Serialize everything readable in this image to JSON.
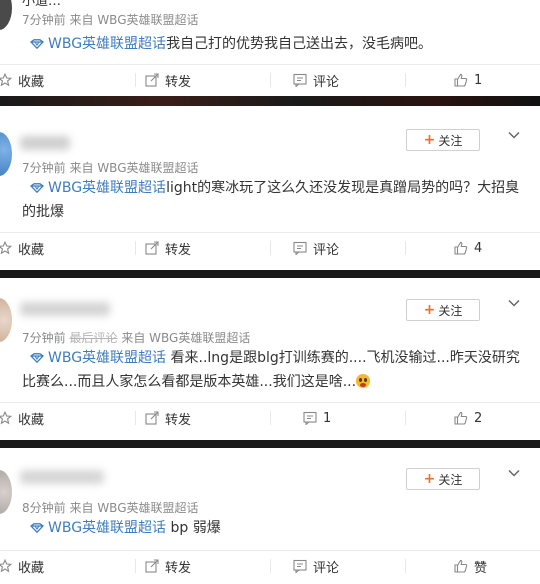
{
  "actions_labels": {
    "collect": "收藏",
    "repost": "转发",
    "comment": "评论"
  },
  "follow_label": "关注",
  "posts": [
    {
      "username_partial": "小道…",
      "meta_time": "7分钟前",
      "meta_from": "来自",
      "meta_source": "WBG英雄联盟超话",
      "topic": "WBG英雄联盟超话",
      "text": "我自己打的优势我自己送出去，没毛病吧。",
      "like_count": "1"
    },
    {
      "meta_time": "7分钟前",
      "meta_from": "来自",
      "meta_source": "WBG英雄联盟超话",
      "topic": "WBG英雄联盟超话",
      "text_line1": "light的寒冰玩了这么久还没发现是真蹭局势的吗？大招臭",
      "text_line2": "的批爆",
      "like_count": "4"
    },
    {
      "meta_time": "7分钟前",
      "meta_struck": "最后评论",
      "meta_from": "来自",
      "meta_source": "WBG英雄联盟超话",
      "topic": "WBG英雄联盟超话",
      "text_line1": "看来..lng是跟blg打训练赛的....飞机没输过...昨天没研究",
      "text_line2": "比赛么...而且人家怎么看都是版本英雄...我们这是啥...",
      "comment_count": "1",
      "like_count": "2"
    },
    {
      "meta_time": "8分钟前",
      "meta_from": "来自",
      "meta_source": "WBG英雄联盟超话",
      "topic": "WBG英雄联盟超话",
      "text": "bp 弱爆",
      "like_label": "赞"
    }
  ]
}
